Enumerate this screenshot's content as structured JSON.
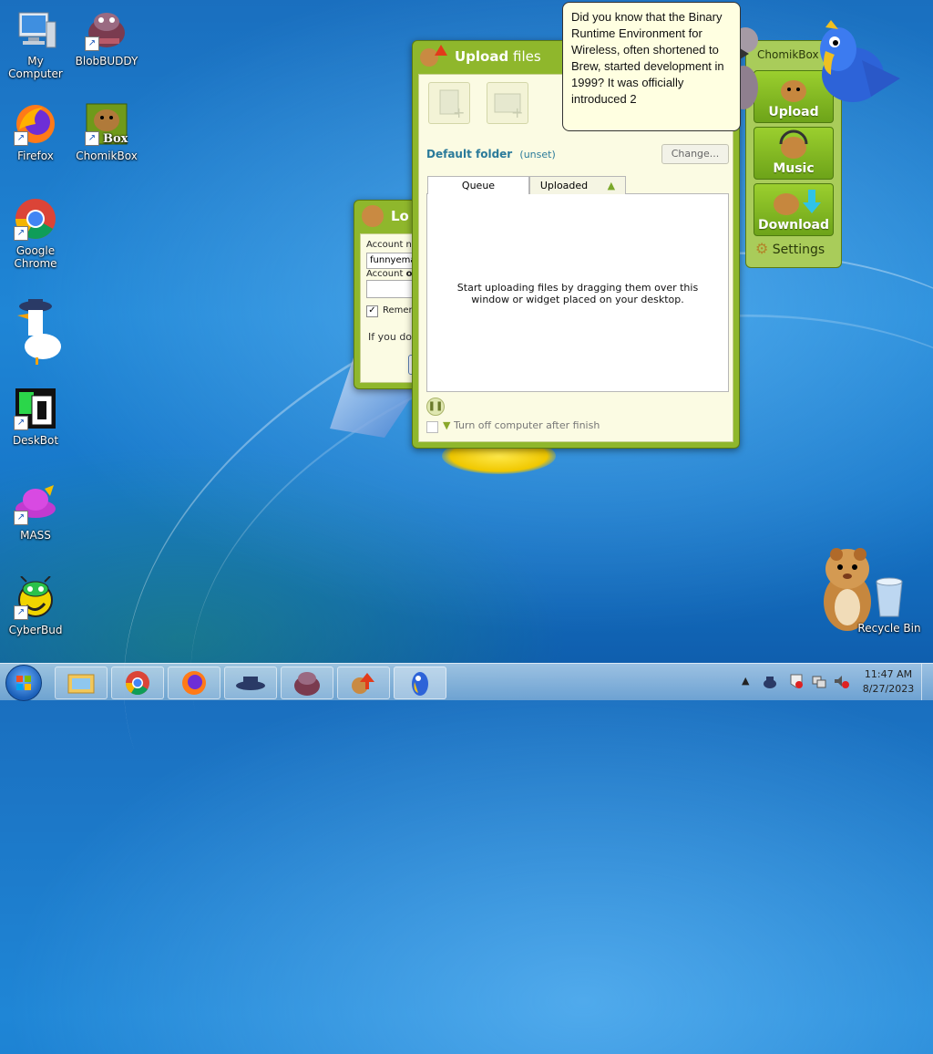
{
  "desktop": {
    "icons": [
      {
        "label": "My Computer"
      },
      {
        "label": "BlobBUDDY"
      },
      {
        "label": "Firefox"
      },
      {
        "label": "ChomikBox"
      },
      {
        "label": "Google Chrome"
      },
      {
        "label": "DeskBot"
      },
      {
        "label": "MASS"
      },
      {
        "label": "CyberBud"
      },
      {
        "label": "Recycle Bin"
      }
    ]
  },
  "bubble": {
    "text": "Did you know that the Binary Runtime Environment for Wireless, often shortened to Brew, started development in 1999? It was officially introduced 2"
  },
  "upload_window": {
    "title_bold": "Upload",
    "title_rest": " files",
    "default_folder_label": "Default folder",
    "default_folder_value": "(unset)",
    "change_button": "Change...",
    "tabs": [
      "Queue",
      "Uploaded"
    ],
    "empty_message": "Start uploading files by dragging them over this window or widget placed on your desktop.",
    "turn_off_label": "Turn off computer after finish"
  },
  "login_window": {
    "title": "Lo",
    "account_name_label": "Account na",
    "account_name_value": "funnyema",
    "account_pw_label_a": "Account ",
    "account_pw_label_b": "ow",
    "remember_label": "Remem",
    "hint_text": "If you don"
  },
  "widget": {
    "title": "ChomikBox",
    "buttons": [
      "Upload",
      "Music",
      "Download"
    ],
    "settings": "Settings"
  },
  "taskbar": {
    "clock_time": "11:47 AM",
    "clock_date": "8/27/2023"
  },
  "colors": {
    "accent": "#8fb72c",
    "link": "#2a7a9a"
  }
}
